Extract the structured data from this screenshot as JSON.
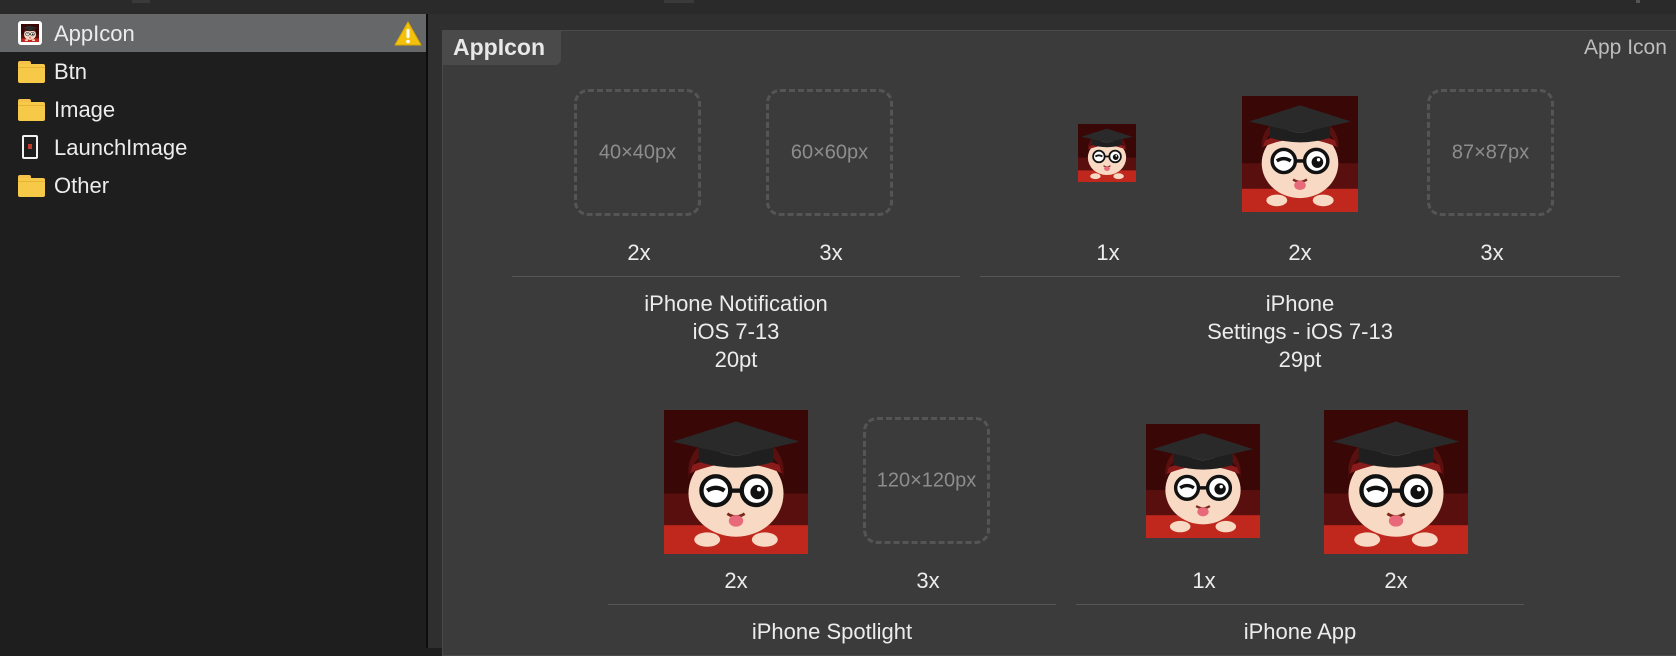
{
  "sidebar": {
    "items": [
      {
        "label": "AppIcon",
        "icon": "appicon-thumbnail-icon",
        "selected": true,
        "warning": true
      },
      {
        "label": "Btn",
        "icon": "folder-icon"
      },
      {
        "label": "Image",
        "icon": "folder-icon"
      },
      {
        "label": "LaunchImage",
        "icon": "launch-image-icon"
      },
      {
        "label": "Other",
        "icon": "folder-icon"
      }
    ]
  },
  "panel": {
    "title": "AppIcon",
    "type_label": "App Icon"
  },
  "slots": {
    "notif_2x": {
      "placeholder": "40×40px",
      "scale": "2x"
    },
    "notif_3x": {
      "placeholder": "60×60px",
      "scale": "3x"
    },
    "settings_1x": {
      "scale": "1x"
    },
    "settings_2x": {
      "scale": "2x"
    },
    "settings_3x": {
      "placeholder": "87×87px",
      "scale": "3x"
    },
    "spot_2x": {
      "scale": "2x"
    },
    "spot_3x": {
      "placeholder": "120×120px",
      "scale": "3x"
    },
    "app_1x": {
      "scale": "1x"
    },
    "app_2x": {
      "scale": "2x"
    }
  },
  "groups": {
    "notification": {
      "line1": "iPhone Notification",
      "line2": "iOS 7-13",
      "line3": "20pt"
    },
    "settings": {
      "line1": "iPhone",
      "line2": "Settings - iOS 7-13",
      "line3": "29pt"
    },
    "spotlight": {
      "line1": "iPhone Spotlight"
    },
    "app": {
      "line1": "iPhone App"
    }
  },
  "colors": {
    "warning": "#f4c20d",
    "folder": "#f7c948",
    "selection": "#666769",
    "icon_red": "#c0271d"
  }
}
